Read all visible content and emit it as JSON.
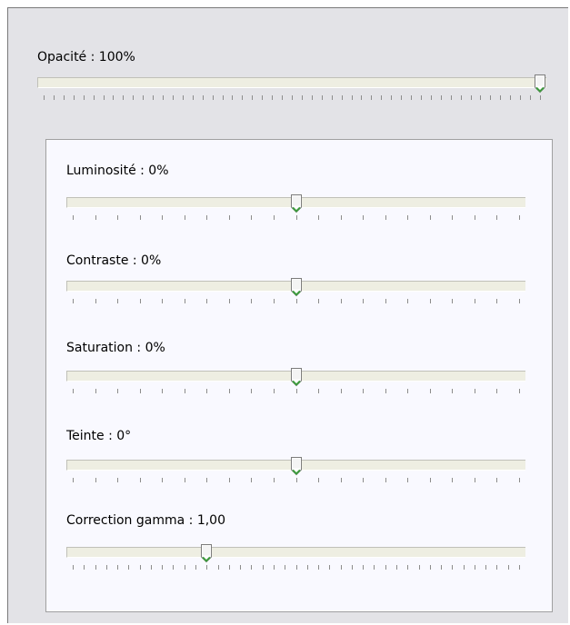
{
  "opacity": {
    "label": "Opacité : 100%",
    "value_fraction": 1.0,
    "tick_count": 51
  },
  "adjustments": [
    {
      "id": "luminosite",
      "label": "Luminosité : 0%",
      "value_fraction": 0.5,
      "tick_count": 21
    },
    {
      "id": "contraste",
      "label": "Contraste : 0%",
      "value_fraction": 0.5,
      "tick_count": 21
    },
    {
      "id": "saturation",
      "label": "Saturation : 0%",
      "value_fraction": 0.5,
      "tick_count": 21
    },
    {
      "id": "teinte",
      "label": "Teinte : 0°",
      "value_fraction": 0.5,
      "tick_count": 21
    },
    {
      "id": "gamma",
      "label": "Correction gamma : 1,00",
      "value_fraction": 0.3,
      "tick_count": 41
    }
  ],
  "colors": {
    "window_background": "#e3e3e7",
    "panel_background": "#f9f9ff",
    "track_fill": "#eeeee2",
    "thumb_accent": "#3c9a3c"
  }
}
